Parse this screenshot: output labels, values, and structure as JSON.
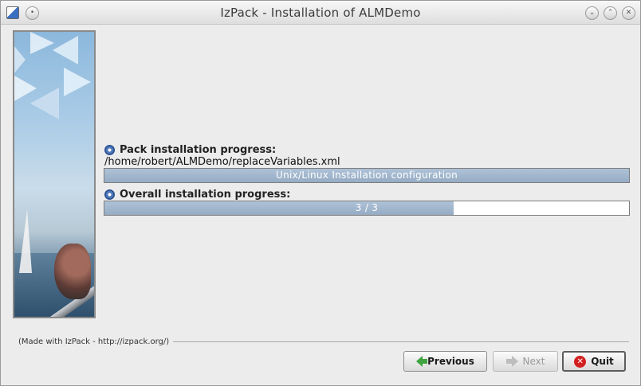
{
  "window": {
    "title": "IzPack - Installation of ALMDemo"
  },
  "icons": {
    "app": "app-icon",
    "minimize": "minimize-icon",
    "maximize": "maximize-icon",
    "close": "close-icon",
    "pack_progress": "gear-icon",
    "overall_progress": "gear-icon",
    "previous": "arrow-left-icon",
    "next": "arrow-right-icon",
    "quit": "quit-icon"
  },
  "install": {
    "pack_label": "Pack installation progress:",
    "current_file": "/home/robert/ALMDemo/replaceVariables.xml",
    "pack_bar_text": "Unix/Linux Installation configuration",
    "pack_progress_fraction": 1.0,
    "overall_label": "Overall installation progress:",
    "overall_bar_text": "3 / 3",
    "overall_progress_fraction": 0.665
  },
  "footer": {
    "made_with": "(Made with IzPack - http://izpack.org/)"
  },
  "buttons": {
    "previous": "Previous",
    "next": "Next",
    "quit": "Quit"
  },
  "colors": {
    "progress_fill": "#9fb4cb",
    "accent_green": "#3fa33f",
    "quit_red": "#d32020"
  }
}
